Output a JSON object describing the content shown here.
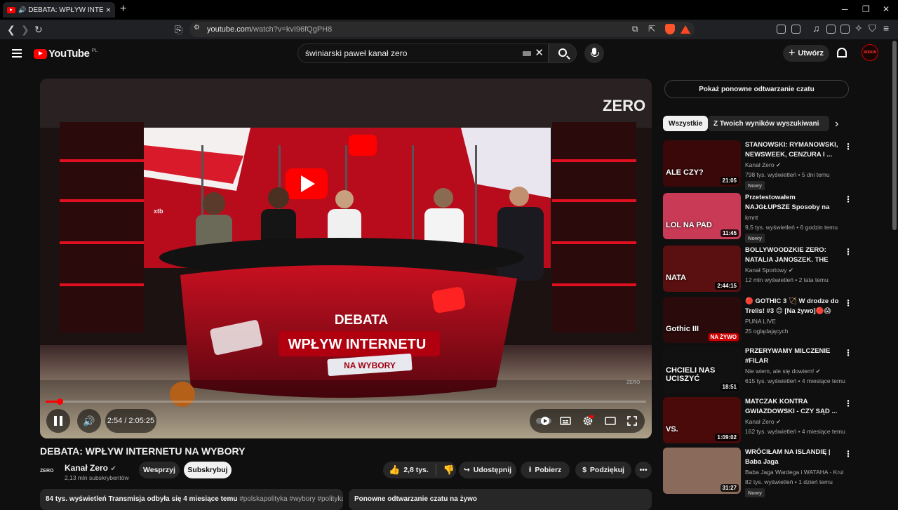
{
  "browser": {
    "tab_title": "DEBATA: WPŁYW INTERNETU",
    "url_domain": "youtube.com",
    "url_path": "/watch?v=kvI96fQgPH8"
  },
  "header": {
    "logo_text": "YouTube",
    "logo_region": "PL",
    "search_query": "świniarski paweł kanał zero",
    "create_label": "Utwórz",
    "avatar_text": "ADRON"
  },
  "player": {
    "time": "2:54 / 2:05:25",
    "progress_fraction": 0.023
  },
  "video": {
    "title": "DEBATA: WPŁYW INTERNETU NA WYBORY",
    "channel_name": "Kanał Zero",
    "channel_logo_text": "ZERO",
    "subscribers": "2,13 mln subskrybentów",
    "support_label": "Wesprzyj",
    "subscribe_label": "Subskrybuj",
    "likes": "2,8 tys.",
    "share_label": "Udostępnij",
    "download_label": "Pobierz",
    "thanks_label": "Podziękuj",
    "desc_stats": "84 tys. wyświetleń  Transmisja odbyła się 4 miesiące temu",
    "desc_tags": "#polskapolityka #wybory #polityka",
    "replay_label": "Ponowne odtwarzanie czatu na żywo"
  },
  "sidebar": {
    "chat_replay_button": "Pokaż ponowne odtwarzanie czatu",
    "chips": [
      "Wszystkie",
      "Z Twoich wyników wyszukiwania"
    ],
    "recommendations": [
      {
        "title": "STANOWSKI: RYMANOWSKI, NEWSWEEK, CENZURA I ...",
        "channel": "Kanał Zero",
        "verified": true,
        "meta": "798 tys. wyświetleń • 5 dni temu",
        "badge": "Nowy",
        "duration": "21:05",
        "thumb_text": "ALE CZY?",
        "thumb_color": "#3a0808"
      },
      {
        "title": "Przetestowałem NAJGŁUPSZE Sposoby na granie w League o...",
        "channel": "kmnt",
        "verified": false,
        "meta": "9,5 tys. wyświetleń • 6 godzin temu",
        "badge": "Nowy",
        "duration": "11:45",
        "thumb_text": "LOL NA PAD",
        "thumb_color": "#c83a55"
      },
      {
        "title": "BOLLYWOODZKIE ZERO: NATALIA JANOSZEK. THE END",
        "channel": "Kanał Sportowy",
        "verified": true,
        "meta": "12 mln wyświetleń • 2 lata temu",
        "badge": "",
        "duration": "2:44:15",
        "thumb_text": "NATA",
        "thumb_color": "#5a1010"
      },
      {
        "title": "🔴 GOTHIC 3 🏹 W drodze do Trelis! #3 😊 [Na żywo]🔴😱",
        "channel": "PUNA LIVE",
        "verified": false,
        "meta": "25 oglądających",
        "badge": "",
        "duration": "NA ŻYWO",
        "thumb_text": "Gothic III",
        "thumb_color": "#2a0a0a"
      },
      {
        "title": "PRZERYWAMY MILCZENIE #FILAR",
        "channel": "Nie wiem, ale się dowiem!",
        "verified": true,
        "meta": "615 tys. wyświetleń • 4 miesiące temu",
        "badge": "",
        "duration": "18:51",
        "thumb_text": "CHCIELI NAS UCISZYĆ",
        "thumb_color": "#111111"
      },
      {
        "title": "MATCZAK KONTRA GWIAZDOWSKI - CZY SĄD ...",
        "channel": "Kanał Zero",
        "verified": true,
        "meta": "162 tys. wyświetleń • 4 miesiące temu",
        "badge": "",
        "duration": "1:09:02",
        "thumb_text": "VS.",
        "thumb_color": "#4a0a0a"
      },
      {
        "title": "WRÓCIŁAM NA ISLANDIĘ | Baba Jaga",
        "channel": "Baba Jaga Wardega i WATAHA - Krulest...",
        "verified": false,
        "meta": "82 tys. wyświetleń • 1 dzień temu",
        "badge": "Nowy",
        "duration": "31:27",
        "thumb_text": "",
        "thumb_color": "#8a6a5a"
      }
    ]
  },
  "set_texts": {
    "zero_logo": "ZERO",
    "sponsor": "xtb",
    "banner_top": "DEBATA",
    "banner_main": "WPŁYW INTERNETU",
    "banner_sub": "NA WYBORY",
    "watermark": "ZERO"
  }
}
